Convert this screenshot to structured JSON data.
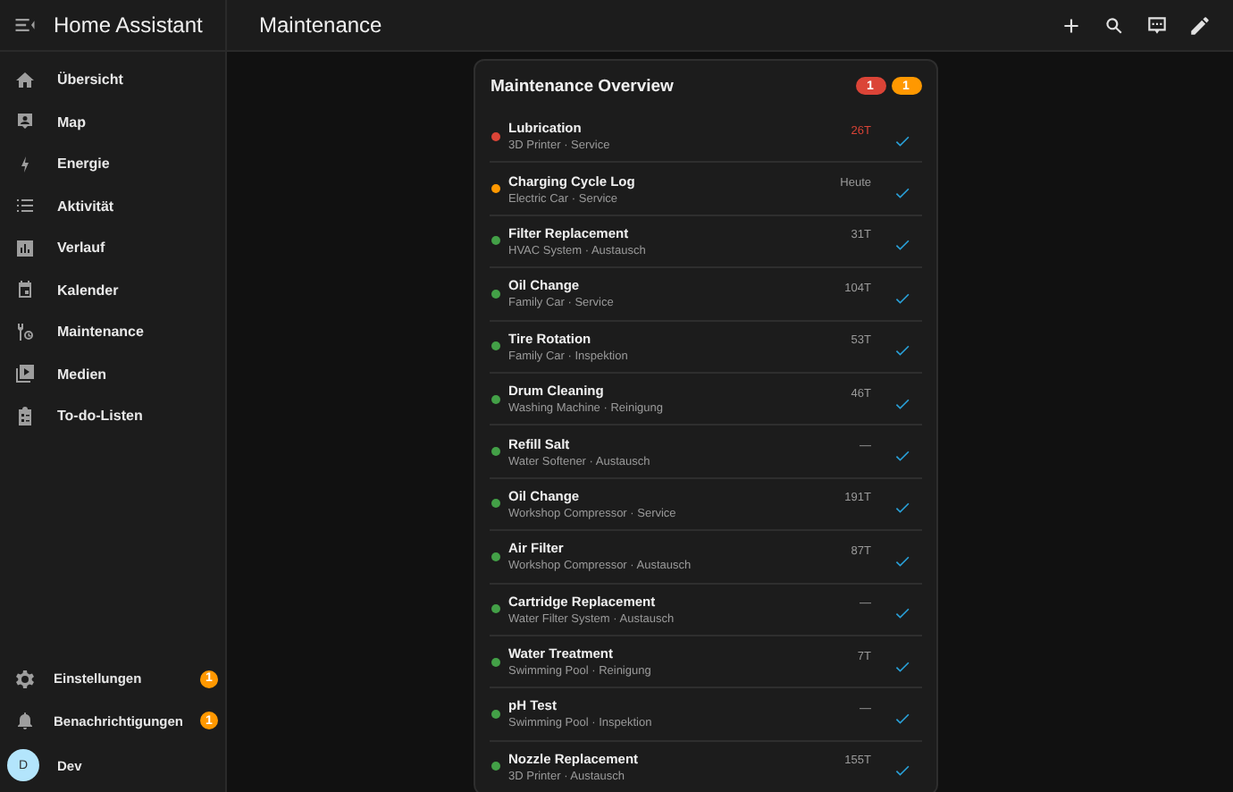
{
  "sidebar": {
    "title": "Home Assistant",
    "items": [
      {
        "label": "Übersicht"
      },
      {
        "label": "Map"
      },
      {
        "label": "Energie"
      },
      {
        "label": "Aktivität"
      },
      {
        "label": "Verlauf"
      },
      {
        "label": "Kalender"
      },
      {
        "label": "Maintenance"
      },
      {
        "label": "Medien"
      },
      {
        "label": "To-do-Listen"
      }
    ],
    "bottom_items": [
      {
        "label": "Einstellungen",
        "badge": "1"
      },
      {
        "label": "Benachrichtigungen",
        "badge": "1"
      }
    ],
    "user": {
      "initial": "D",
      "name": "Dev"
    }
  },
  "header": {
    "title": "Maintenance"
  },
  "card": {
    "title": "Maintenance Overview",
    "badges": [
      {
        "text": "1",
        "color": "#db4437"
      },
      {
        "text": "1",
        "color": "#ff9800"
      }
    ],
    "rows": [
      {
        "title": "Lubrication",
        "subtitle": "3D Printer · Service",
        "value": "26T",
        "overdue": true,
        "color": "#db4437"
      },
      {
        "title": "Charging Cycle Log",
        "subtitle": "Electric Car · Service",
        "value": "Heute",
        "overdue": false,
        "color": "#ff9800"
      },
      {
        "title": "Filter Replacement",
        "subtitle": "HVAC System · Austausch",
        "value": "31T",
        "overdue": false,
        "color": "#43a047"
      },
      {
        "title": "Oil Change",
        "subtitle": "Family Car · Service",
        "value": "104T",
        "overdue": false,
        "color": "#43a047"
      },
      {
        "title": "Tire Rotation",
        "subtitle": "Family Car · Inspektion",
        "value": "53T",
        "overdue": false,
        "color": "#43a047"
      },
      {
        "title": "Drum Cleaning",
        "subtitle": "Washing Machine · Reinigung",
        "value": "46T",
        "overdue": false,
        "color": "#43a047"
      },
      {
        "title": "Refill Salt",
        "subtitle": "Water Softener · Austausch",
        "value": "—",
        "overdue": false,
        "color": "#43a047"
      },
      {
        "title": "Oil Change",
        "subtitle": "Workshop Compressor · Service",
        "value": "191T",
        "overdue": false,
        "color": "#43a047"
      },
      {
        "title": "Air Filter",
        "subtitle": "Workshop Compressor · Austausch",
        "value": "87T",
        "overdue": false,
        "color": "#43a047"
      },
      {
        "title": "Cartridge Replacement",
        "subtitle": "Water Filter System · Austausch",
        "value": "—",
        "overdue": false,
        "color": "#43a047"
      },
      {
        "title": "Water Treatment",
        "subtitle": "Swimming Pool · Reinigung",
        "value": "7T",
        "overdue": false,
        "color": "#43a047"
      },
      {
        "title": "pH Test",
        "subtitle": "Swimming Pool · Inspektion",
        "value": "—",
        "overdue": false,
        "color": "#43a047"
      },
      {
        "title": "Nozzle Replacement",
        "subtitle": "3D Printer · Austausch",
        "value": "155T",
        "overdue": false,
        "color": "#43a047"
      }
    ]
  }
}
